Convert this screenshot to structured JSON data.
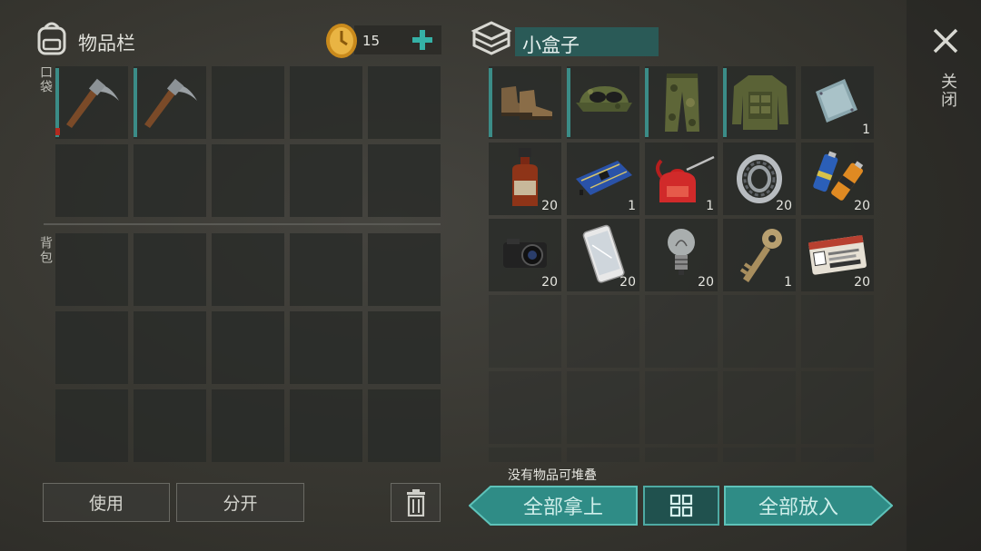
{
  "inventory": {
    "title": "物品栏",
    "coins": "15",
    "pocket_label": "口袋",
    "backpack_label": "背包"
  },
  "container": {
    "title": "小盒子"
  },
  "close_label": "关闭",
  "buttons": {
    "use": "使用",
    "split": "分开",
    "take_all": "全部拿上",
    "put_all": "全部放入"
  },
  "stack_message": "没有物品可堆叠",
  "container_items": [
    {
      "icon": "boots-icon",
      "count": ""
    },
    {
      "icon": "cap-icon",
      "count": ""
    },
    {
      "icon": "camo-pants-icon",
      "count": ""
    },
    {
      "icon": "camo-jacket-icon",
      "count": ""
    },
    {
      "icon": "metal-plate-icon",
      "count": "1"
    },
    {
      "icon": "bottle-icon",
      "count": "20"
    },
    {
      "icon": "circuit-board-icon",
      "count": "1"
    },
    {
      "icon": "oil-can-icon",
      "count": "1"
    },
    {
      "icon": "bearing-icon",
      "count": "20"
    },
    {
      "icon": "batteries-icon",
      "count": "20"
    },
    {
      "icon": "camera-icon",
      "count": "20"
    },
    {
      "icon": "smartphone-icon",
      "count": "20"
    },
    {
      "icon": "light-bulb-icon",
      "count": "20"
    },
    {
      "icon": "key-icon",
      "count": "1"
    },
    {
      "icon": "id-card-icon",
      "count": "20"
    }
  ],
  "pocket_items": [
    {
      "icon": "pickaxe-icon"
    },
    {
      "icon": "pickaxe-icon"
    }
  ],
  "colors": {
    "accent": "#2f8c86"
  }
}
